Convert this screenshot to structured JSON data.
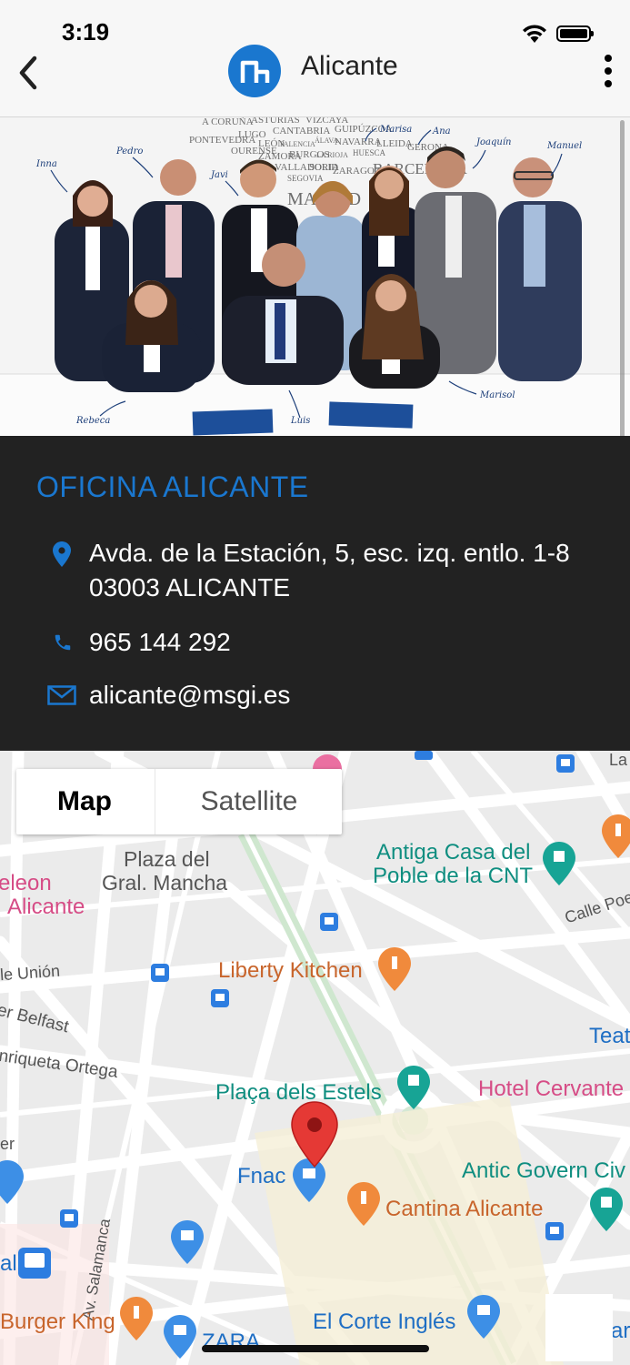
{
  "status_bar": {
    "time": "3:19"
  },
  "nav": {
    "title": "Alicante"
  },
  "photo": {
    "wall_words": [
      "A CORUÑA",
      "ASTURIAS",
      "VIZCAYA",
      "PONTEVEDRA",
      "LUGO",
      "CANTABRIA",
      "GUIPÚZCOA",
      "OURENSE",
      "LEÓN",
      "PALENCIA",
      "ÁLAVA",
      "NAVARRA",
      "LLEIDA",
      "GERONA",
      "ZAMORA",
      "BURGOS",
      "LA RIOJA",
      "HUESCA",
      "VALLADOLID",
      "SORIA",
      "ZARAGOZA",
      "BARCELONA",
      "SEGOVIA",
      "MADRID"
    ],
    "names": [
      "Inna",
      "Pedro",
      "Javi",
      "Marisa",
      "Ana",
      "Joaquín",
      "Manuel",
      "Rebeca",
      "Luis",
      "Marisol"
    ]
  },
  "office": {
    "title": "OFICINA ALICANTE",
    "address_line1": "Avda. de la Estación, 5, esc. izq. entlo. 1-8",
    "address_line2": "03003 ALICANTE",
    "phone": "965 144 292",
    "email": "alicante@msgi.es"
  },
  "map": {
    "tab_map": "Map",
    "tab_satellite": "Satellite",
    "labels": {
      "plaza_gral_1": "Plaza del",
      "plaza_gral_2": "Gral. Mancha",
      "antiga_1": "Antiga Casa del",
      "antiga_2": "Poble de la CNT",
      "teleon_1": "eleon",
      "teleon_2": "Alicante",
      "calle_poeta": "Calle Poe",
      "union": "le Unión",
      "liberty": "Liberty Kitchen",
      "belfast": "er Belfast",
      "enriqueta": "nriqueta Ortega",
      "teat": "Teat",
      "placa": "Plaça dels Estels",
      "hotel": "Hotel Cervante",
      "fnac": "Fnac",
      "antic": "Antic Govern Civ",
      "cantina": "Cantina Alicante",
      "salamanca": "Av. Salamanca",
      "al": "al",
      "burger": "Burger King",
      "corte": "El Corte Inglés",
      "zara": "ZARA",
      "er": "er",
      "la": "La",
      "arl": "arl"
    }
  },
  "colors": {
    "accent": "#1a77cf",
    "card_bg": "#222222",
    "marker_red": "#e53935"
  }
}
